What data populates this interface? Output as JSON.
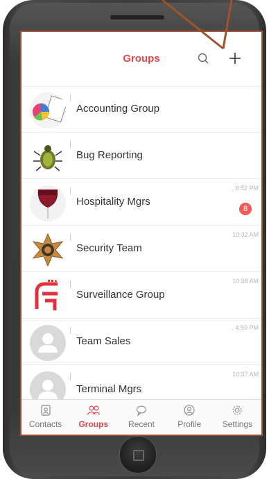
{
  "header": {
    "title": "Groups"
  },
  "groups": [
    {
      "name": "Accounting Group",
      "time": "",
      "badge": ""
    },
    {
      "name": "Bug Reporting",
      "time": "",
      "badge": ""
    },
    {
      "name": "Hospitality Mgrs",
      "time": ", 8:52 PM",
      "badge": "8"
    },
    {
      "name": "Security Team",
      "time": "10:32 AM",
      "badge": ""
    },
    {
      "name": "Surveillance Group",
      "time": "10:38 AM",
      "badge": ""
    },
    {
      "name": "Team Sales",
      "time": ", 4:59 PM",
      "badge": ""
    },
    {
      "name": "Terminal Mgrs",
      "time": "10:37 AM",
      "badge": ""
    }
  ],
  "tabs": [
    {
      "label": "Contacts",
      "icon": "contacts-icon"
    },
    {
      "label": "Groups",
      "icon": "groups-icon"
    },
    {
      "label": "Recent",
      "icon": "chat-bubble-icon"
    },
    {
      "label": "Profile",
      "icon": "profile-icon"
    },
    {
      "label": "Settings",
      "icon": "gear-icon"
    }
  ],
  "colors": {
    "accent": "#e0474c",
    "badge": "#ef5a5a",
    "annotation": "#a0522d"
  }
}
